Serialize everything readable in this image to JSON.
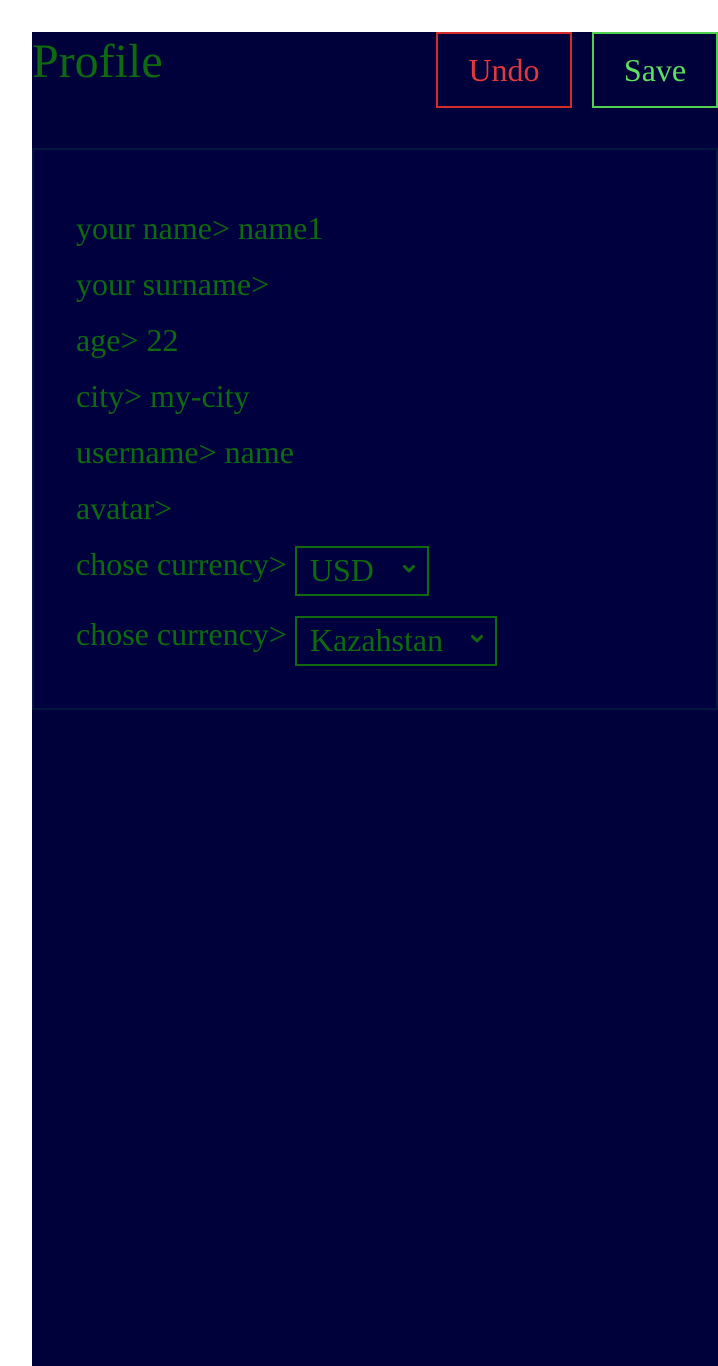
{
  "header": {
    "title": "Profile",
    "undo_label": "Undo",
    "save_label": "Save"
  },
  "profile": {
    "name_label": "your name>",
    "name_value": "name1",
    "surname_label": "your surname>",
    "surname_value": "",
    "age_label": "age>",
    "age_value": "22",
    "city_label": "city>",
    "city_value": "my-city",
    "username_label": "username>",
    "username_value": "name",
    "avatar_label": "avatar>",
    "avatar_value": ""
  },
  "selects": {
    "currency_label": "chose currency>",
    "currency_value": "USD",
    "country_label": "chose currency>",
    "country_value": "Kazahstan"
  },
  "colors": {
    "background": "#00003a",
    "text_green": "#0e6a0e",
    "undo_red": "#e23a3a",
    "save_green": "#5ee05e"
  },
  "icons": {
    "select_arrow": "chevron-down-icon"
  }
}
